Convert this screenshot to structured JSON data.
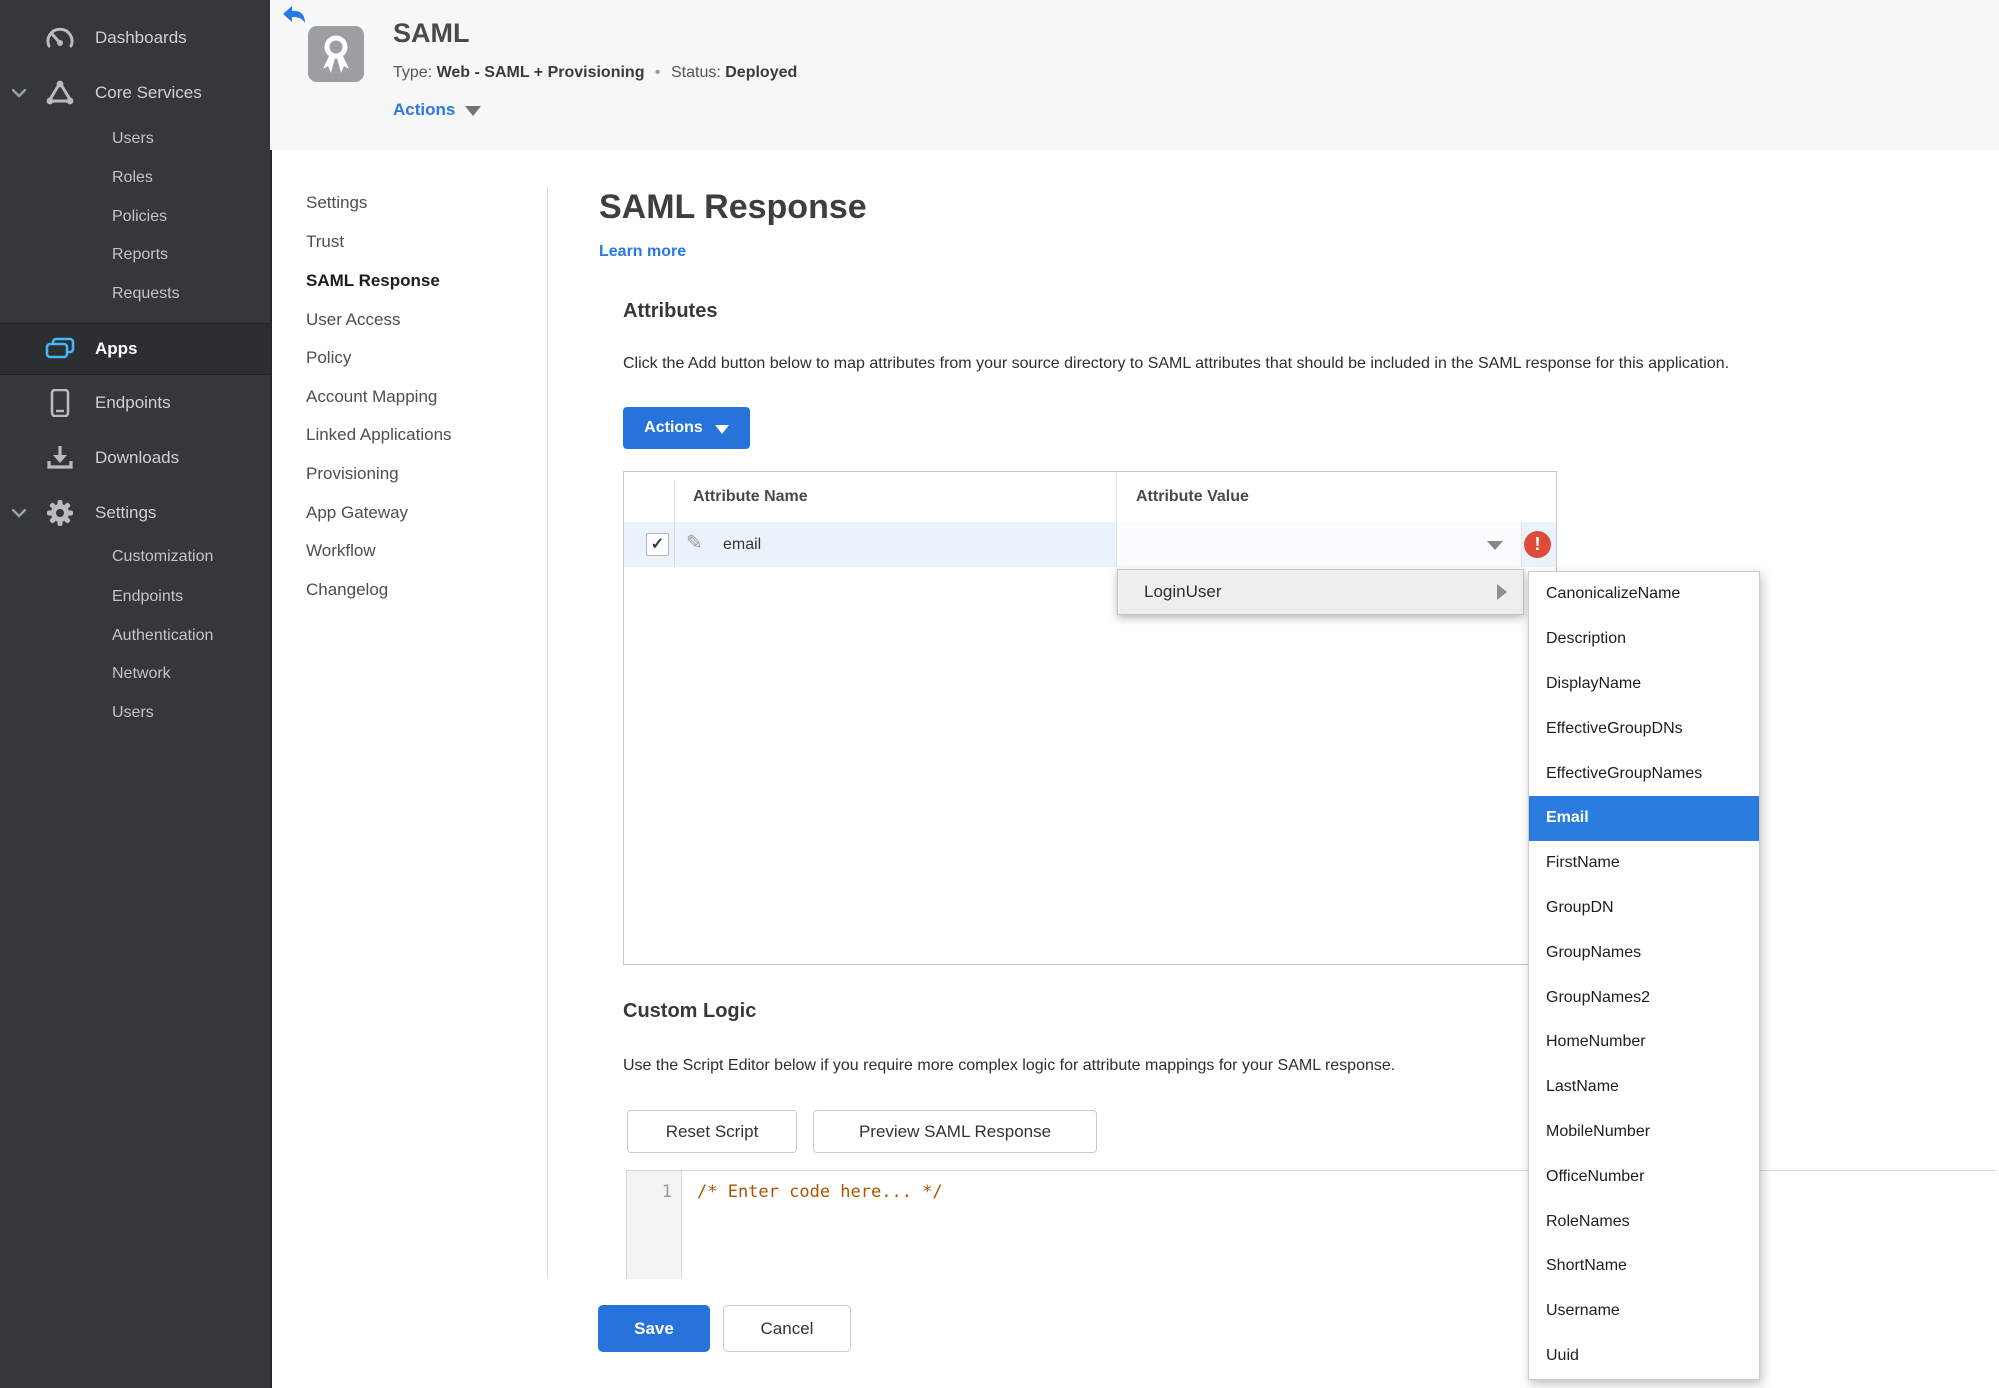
{
  "colors": {
    "accent_blue": "#2673dc",
    "link_blue": "#2b78e4",
    "selection_blue": "#2b7cdf",
    "error_red": "#dd4b39",
    "success_green": "#3f8a2a",
    "sidebar_bg": "#35383a",
    "row_highlight": "#eaf2fc"
  },
  "sidebar": {
    "dashboards": "Dashboards",
    "core_services": "Core Services",
    "core_children": [
      "Users",
      "Roles",
      "Policies",
      "Reports",
      "Requests"
    ],
    "apps": "Apps",
    "endpoints": "Endpoints",
    "downloads": "Downloads",
    "settings": "Settings",
    "settings_children": [
      "Customization",
      "Endpoints",
      "Authentication",
      "Network",
      "Users"
    ]
  },
  "header": {
    "title": "SAML",
    "type_label": "Type:",
    "type_value": "Web - SAML + Provisioning",
    "separator": "•",
    "status_label": "Status:",
    "status_value": "Deployed",
    "actions_label": "Actions"
  },
  "subnav": {
    "items": [
      "Settings",
      "Trust",
      "SAML Response",
      "User Access",
      "Policy",
      "Account Mapping",
      "Linked Applications",
      "Provisioning",
      "App Gateway",
      "Workflow",
      "Changelog"
    ]
  },
  "main": {
    "title": "SAML Response",
    "learn_more": "Learn more",
    "attributes": {
      "heading": "Attributes",
      "description": "Click the Add button below to map attributes from your source directory to SAML attributes that should be included in the SAML response for this application.",
      "actions_button": "Actions",
      "table": {
        "col_name": "Attribute Name",
        "col_value": "Attribute Value",
        "row": {
          "name": "email",
          "checked": "✓"
        }
      }
    },
    "dropdown": {
      "label": "LoginUser",
      "submenu_items": [
        "CanonicalizeName",
        "Description",
        "DisplayName",
        "EffectiveGroupDNs",
        "EffectiveGroupNames",
        "Email",
        "FirstName",
        "GroupDN",
        "GroupNames",
        "GroupNames2",
        "HomeNumber",
        "LastName",
        "MobileNumber",
        "OfficeNumber",
        "RoleNames",
        "ShortName",
        "Username",
        "Uuid"
      ],
      "selected_item": "Email"
    },
    "custom_logic": {
      "heading": "Custom Logic",
      "description": "Use the Script Editor below if you require more complex logic for attribute mappings for your SAML response.",
      "reset_button": "Reset Script",
      "preview_button": "Preview SAML Response",
      "editor_line_number": "1",
      "editor_code": "/* Enter code here... */"
    },
    "footer": {
      "save": "Save",
      "cancel": "Cancel"
    }
  }
}
